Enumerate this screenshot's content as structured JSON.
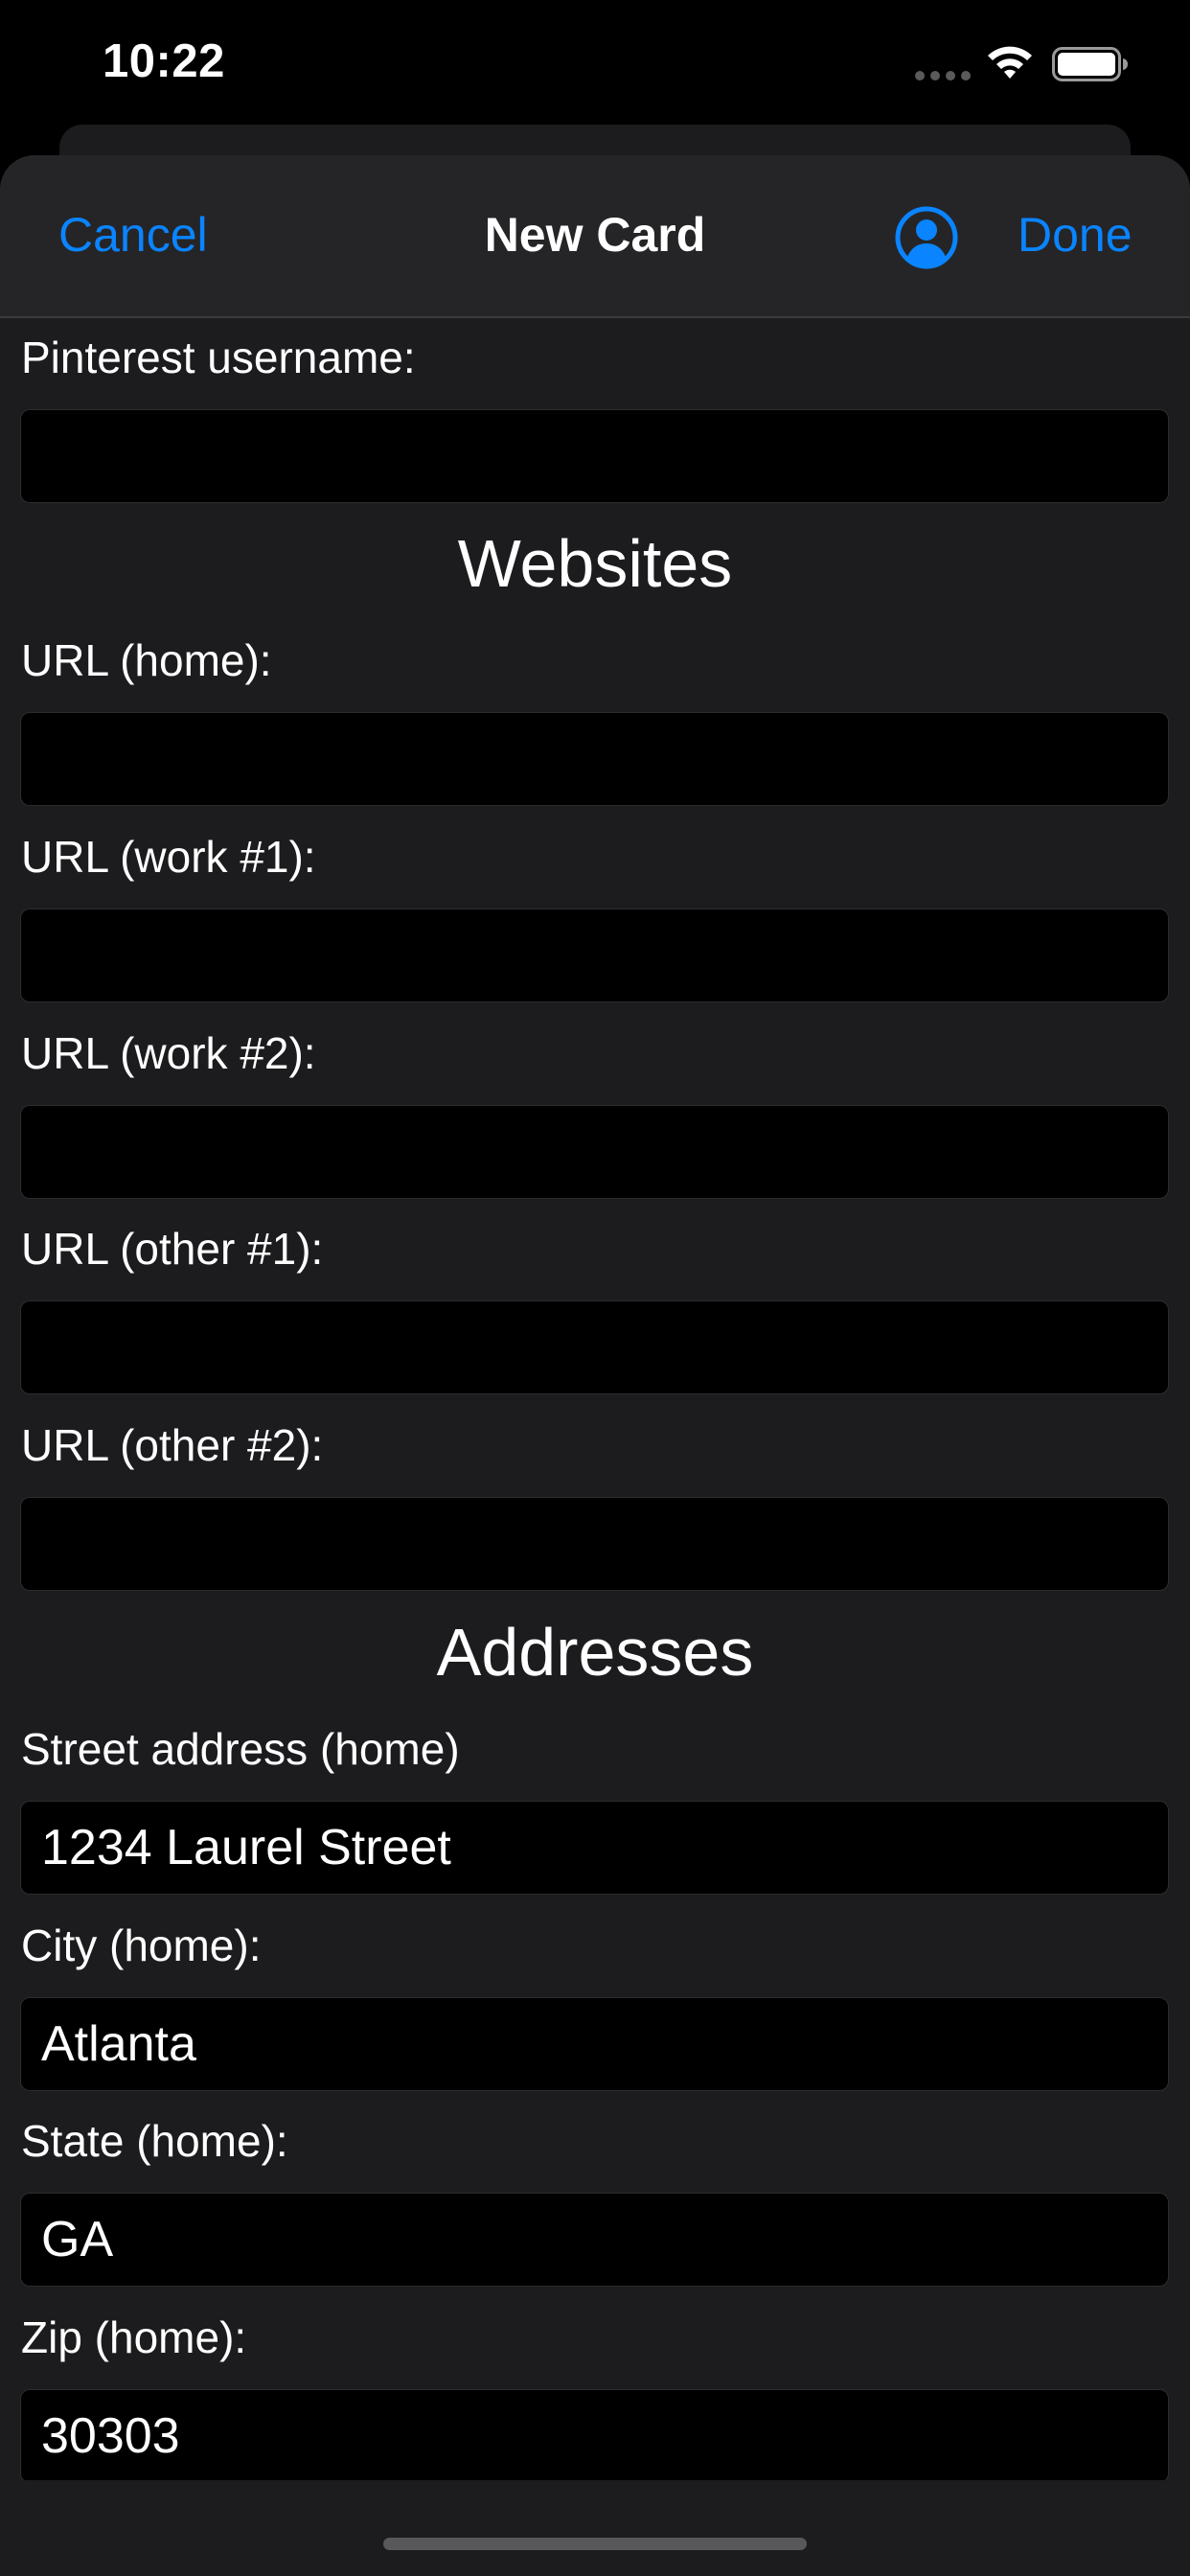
{
  "status_bar": {
    "time": "10:22",
    "icons": [
      "signal-dots-icon",
      "wifi-icon",
      "battery-icon"
    ]
  },
  "nav": {
    "cancel_label": "Cancel",
    "title": "New Card",
    "person_icon": "person-circle-icon",
    "done_label": "Done"
  },
  "colors": {
    "accent": "#0a84ff",
    "sheet_bg": "#1c1c1e",
    "nav_bg": "#252527",
    "input_bg": "#000000",
    "text": "#ffffff"
  },
  "form": {
    "pinterest": {
      "label": "Pinterest username:",
      "value": ""
    },
    "websites_header": "Websites",
    "url_home": {
      "label": "URL (home):",
      "value": ""
    },
    "url_work1": {
      "label": "URL (work #1):",
      "value": ""
    },
    "url_work2": {
      "label": "URL (work #2):",
      "value": ""
    },
    "url_other1": {
      "label": "URL (other #1):",
      "value": ""
    },
    "url_other2": {
      "label": "URL (other #2):",
      "value": ""
    },
    "addresses_header": "Addresses",
    "street_home": {
      "label": "Street address (home)",
      "value": "1234 Laurel Street"
    },
    "city_home": {
      "label": "City (home):",
      "value": "Atlanta"
    },
    "state_home": {
      "label": "State (home):",
      "value": "GA"
    },
    "zip_home": {
      "label": "Zip (home):",
      "value": "30303"
    }
  }
}
